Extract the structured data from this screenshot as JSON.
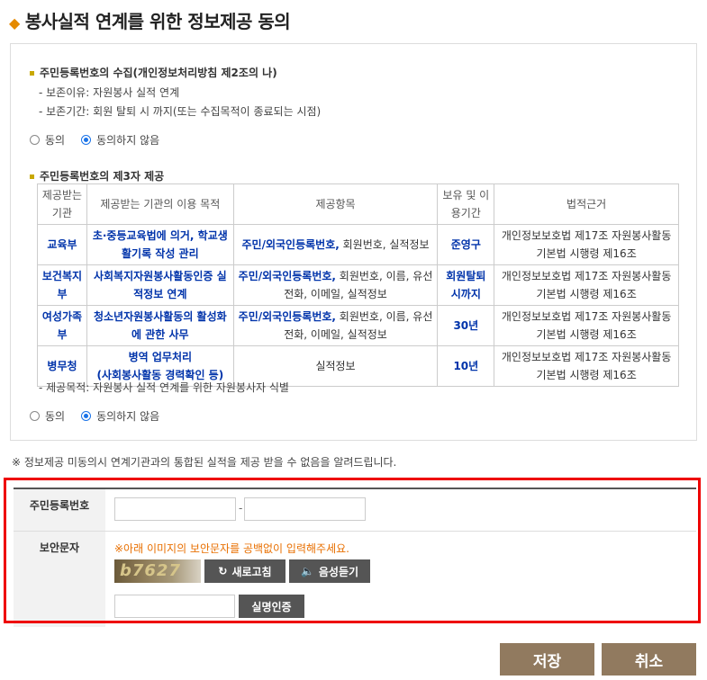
{
  "page_title": "봉사실적 연계를 위한 정보제공 동의",
  "section1": {
    "heading": "주민등록번호의 수집(개인정보처리방침 제2조의 나)",
    "lines": [
      "- 보존이유: 자원봉사 실적 연계",
      "- 보존기간: 회원 탈퇴 시 까지(또는 수집목적이 종료되는 시점)"
    ],
    "agree": "동의",
    "disagree": "동의하지 않음"
  },
  "section2": {
    "heading": "주민등록번호의 제3자 제공",
    "headers": [
      "제공받는\n기관",
      "제공받는 기관의 이용 목적",
      "제공항목",
      "보유 및 이\n용기간",
      "법적근거"
    ],
    "rows": [
      {
        "org": "교육부",
        "purpose": "초·중등교육법에 의거, 학교생활기록 작성 관리",
        "items_bold": "주민/외국인등록번호,",
        "items_rest": " 회원번호, 실적정보",
        "period": "준영구",
        "law": "개인정보보호법 제17조 자원봉사활동 기본법 시행령 제16조"
      },
      {
        "org": "보건복지부",
        "purpose": "사회복지자원봉사활동인증 실적정보 연계",
        "items_bold": "주민/외국인등록번호,",
        "items_rest": " 회원번호, 이름, 유선전화, 이메일, 실적정보",
        "period": "회원탈퇴시까지",
        "law": "개인정보보호법 제17조 자원봉사활동 기본법 시행령 제16조"
      },
      {
        "org": "여성가족부",
        "purpose": "청소년자원봉사활동의 활성화에 관한 사무",
        "items_bold": "주민/외국인등록번호,",
        "items_rest": " 회원번호, 이름, 유선전화, 이메일, 실적정보",
        "period": "30년",
        "law": "개인정보보호법 제17조 자원봉사활동 기본법 시행령 제16조"
      },
      {
        "org": "병무청",
        "purpose": "병역 업무처리\n(사회봉사활동 경력확인 등)",
        "items_bold": "",
        "items_rest": "실적정보",
        "period": "10년",
        "law": "개인정보보호법 제17조 자원봉사활동 기본법 시행령 제16조"
      }
    ],
    "footnote": "- 제공목적: 자원봉사 실적 연계를 위한 자원봉사자 식별",
    "agree": "동의",
    "disagree": "동의하지 않음"
  },
  "notice": "※ 정보제공 미동의시 연계기관과의 통합된 실적을 제공 받을 수 없음을 알려드립니다.",
  "form": {
    "rrn_label": "주민등록번호",
    "rrn_sep": "-",
    "captcha_label": "보안문자",
    "captcha_warning": "※아래 이미지의 보안문자를 공백없이 입력해주세요.",
    "captcha_text": "b7627",
    "refresh_label": "새로고침",
    "audio_label": "음성듣기",
    "verify_label": "실명인증"
  },
  "actions": {
    "save": "저장",
    "cancel": "취소"
  }
}
